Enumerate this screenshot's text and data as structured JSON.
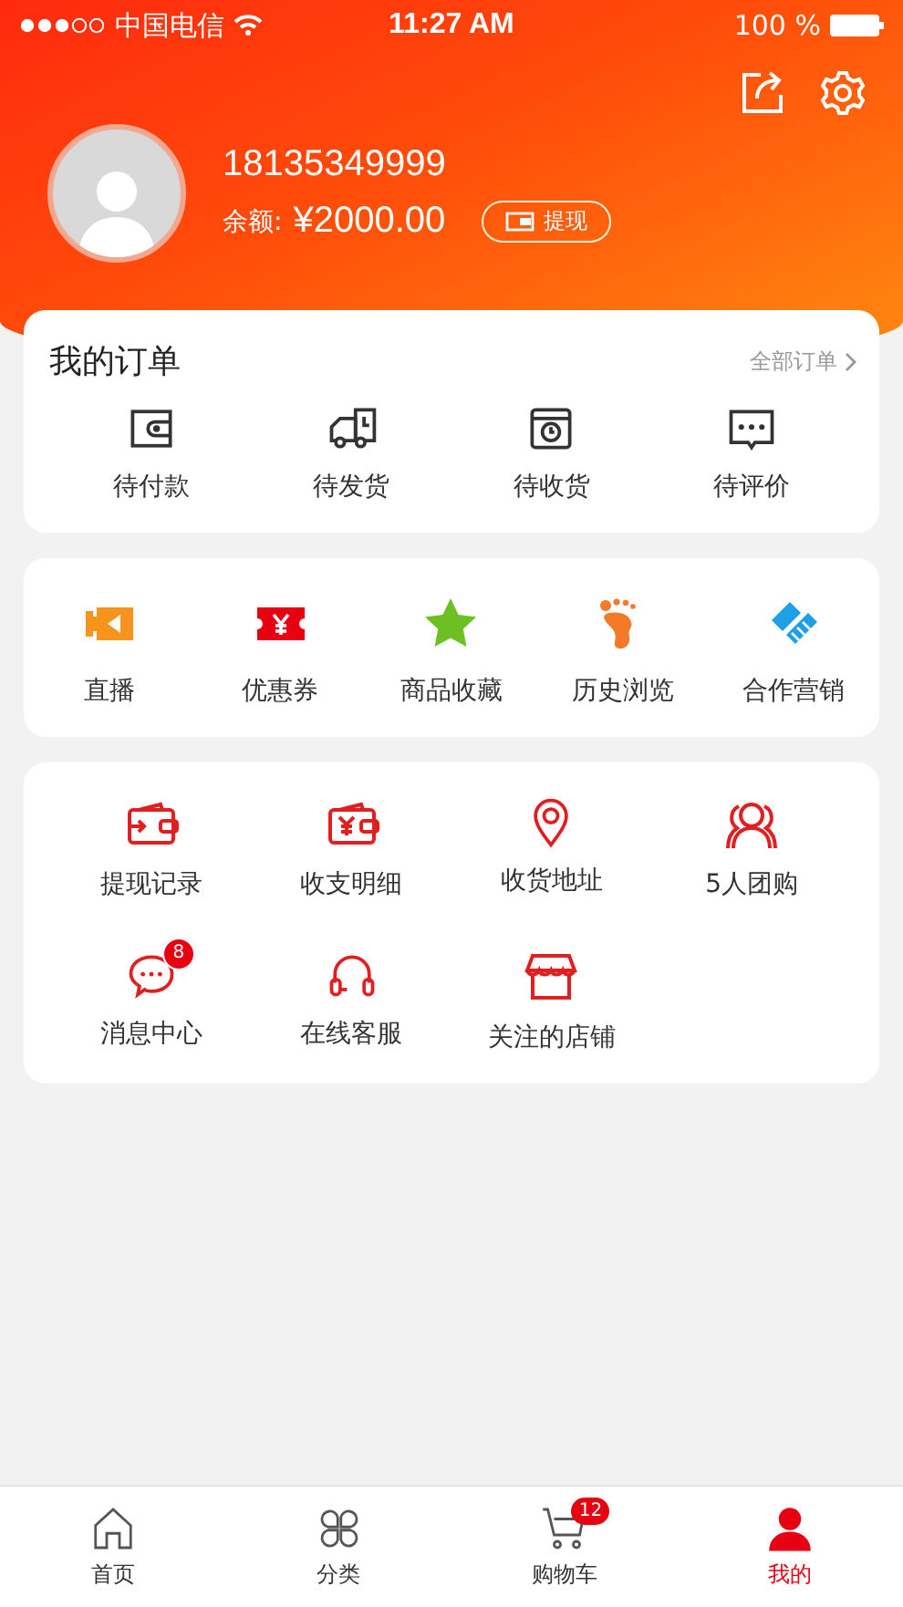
{
  "status_bar": {
    "carrier": "中国电信",
    "time": "11:27 AM",
    "battery": "100 %"
  },
  "header": {
    "phone": "18135349999",
    "balance_label": "余额:",
    "balance": "¥2000.00",
    "withdraw_button": "提现"
  },
  "orders": {
    "title": "我的订单",
    "all_link": "全部订单",
    "items": [
      {
        "label": "待付款"
      },
      {
        "label": "待发货"
      },
      {
        "label": "待收货"
      },
      {
        "label": "待评价"
      }
    ]
  },
  "shortcuts": {
    "items": [
      {
        "label": "直播"
      },
      {
        "label": "优惠券"
      },
      {
        "label": "商品收藏"
      },
      {
        "label": "历史浏览"
      },
      {
        "label": "合作营销"
      }
    ]
  },
  "services": {
    "items": [
      {
        "label": "提现记录"
      },
      {
        "label": "收支明细"
      },
      {
        "label": "收货地址"
      },
      {
        "label": "5人团购"
      },
      {
        "label": "消息中心",
        "badge": "8"
      },
      {
        "label": "在线客服"
      },
      {
        "label": "关注的店铺"
      }
    ]
  },
  "tab_bar": {
    "items": [
      {
        "label": "首页",
        "selected": false
      },
      {
        "label": "分类",
        "selected": false
      },
      {
        "label": "购物车",
        "selected": false,
        "badge": "12"
      },
      {
        "label": "我的",
        "selected": true
      }
    ]
  }
}
